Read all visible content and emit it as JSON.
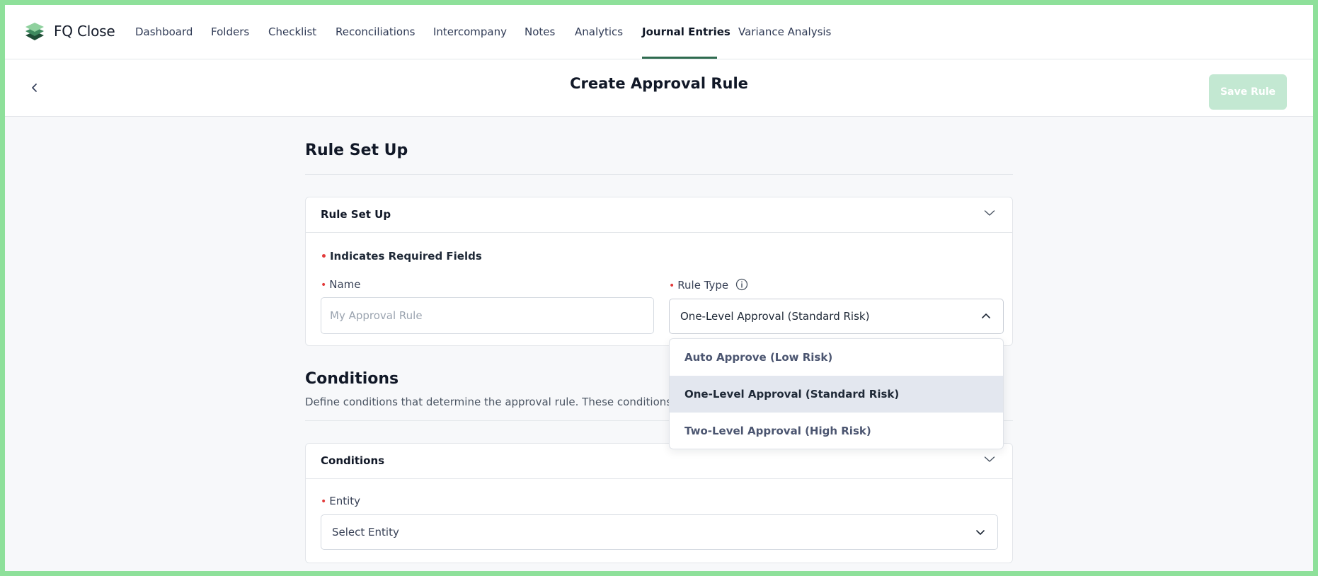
{
  "app": {
    "brand": "FQ Close",
    "colors": {
      "accent": "#2e6b4f",
      "save_button_disabled": "#c3e8d2",
      "required": "#e23b3b"
    }
  },
  "nav": {
    "items": [
      {
        "label": "Dashboard",
        "active": false
      },
      {
        "label": "Folders",
        "active": false
      },
      {
        "label": "Checklist",
        "active": false
      },
      {
        "label": "Reconciliations",
        "active": false
      },
      {
        "label": "Intercompany",
        "active": false
      },
      {
        "label": "Notes",
        "active": false
      },
      {
        "label": "Analytics",
        "active": false
      },
      {
        "label": "Journal Entries",
        "active": true
      },
      {
        "label": "Variance Analysis",
        "active": false
      }
    ]
  },
  "header": {
    "title": "Create Approval Rule",
    "save_label": "Save Rule",
    "back_icon": "chevron-left-icon"
  },
  "rule_setup": {
    "section_title": "Rule Set Up",
    "card_title": "Rule Set Up",
    "required_note": "Indicates Required Fields",
    "name_label": "Name",
    "name_placeholder": "My Approval Rule",
    "name_value": "",
    "rule_type_label": "Rule Type",
    "rule_type_value": "One-Level Approval (Standard Risk)",
    "rule_type_options": [
      {
        "label": "Auto Approve (Low Risk)",
        "selected": false
      },
      {
        "label": "One-Level Approval (Standard Risk)",
        "selected": true
      },
      {
        "label": "Two-Level Approval (High Risk)",
        "selected": false
      }
    ]
  },
  "conditions": {
    "section_title": "Conditions",
    "description": "Define conditions that determine the approval rule. These conditions will",
    "card_title": "Conditions",
    "entity_label": "Entity",
    "entity_value": "Select Entity"
  }
}
